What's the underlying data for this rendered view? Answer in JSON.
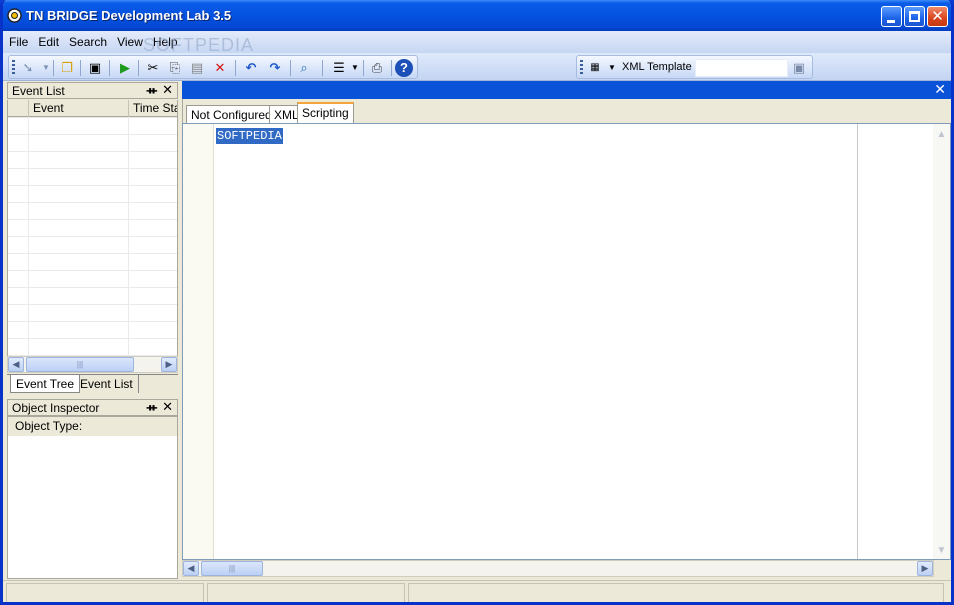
{
  "window": {
    "title": "TN BRIDGE Development Lab 3.5"
  },
  "menu": {
    "items": [
      "File",
      "Edit",
      "Search",
      "View",
      "Help"
    ],
    "watermark": "SOFTPEDIA"
  },
  "toolbar": {
    "icons": [
      "pointer-icon",
      "open-folder-icon",
      "save-icon",
      "run-icon",
      "cut-icon",
      "copy-icon",
      "paste-icon",
      "delete-icon",
      "undo-icon",
      "redo-icon",
      "find-icon",
      "list-options-icon",
      "print-icon",
      "help-icon"
    ]
  },
  "xml_toolbar": {
    "label": "XML Template",
    "value": ""
  },
  "event_list": {
    "title": "Event List",
    "pin": "ᚑ",
    "close": "✕",
    "columns": [
      "Event",
      "Time Star"
    ],
    "scroll_thumb": "|||"
  },
  "bottom_tabs": [
    "Event Tree",
    "Event List"
  ],
  "inspector": {
    "title": "Object Inspector",
    "row_label": "Object Type:",
    "pin": "ᚑ",
    "close": "✕"
  },
  "doc": {
    "close": "✕",
    "tabs": [
      "Not Configured",
      "XML",
      "Scripting"
    ],
    "active_tab": "Scripting",
    "code": "SOFTPEDIA",
    "scroll_thumb": "|||"
  },
  "status": [
    "",
    "",
    ""
  ]
}
